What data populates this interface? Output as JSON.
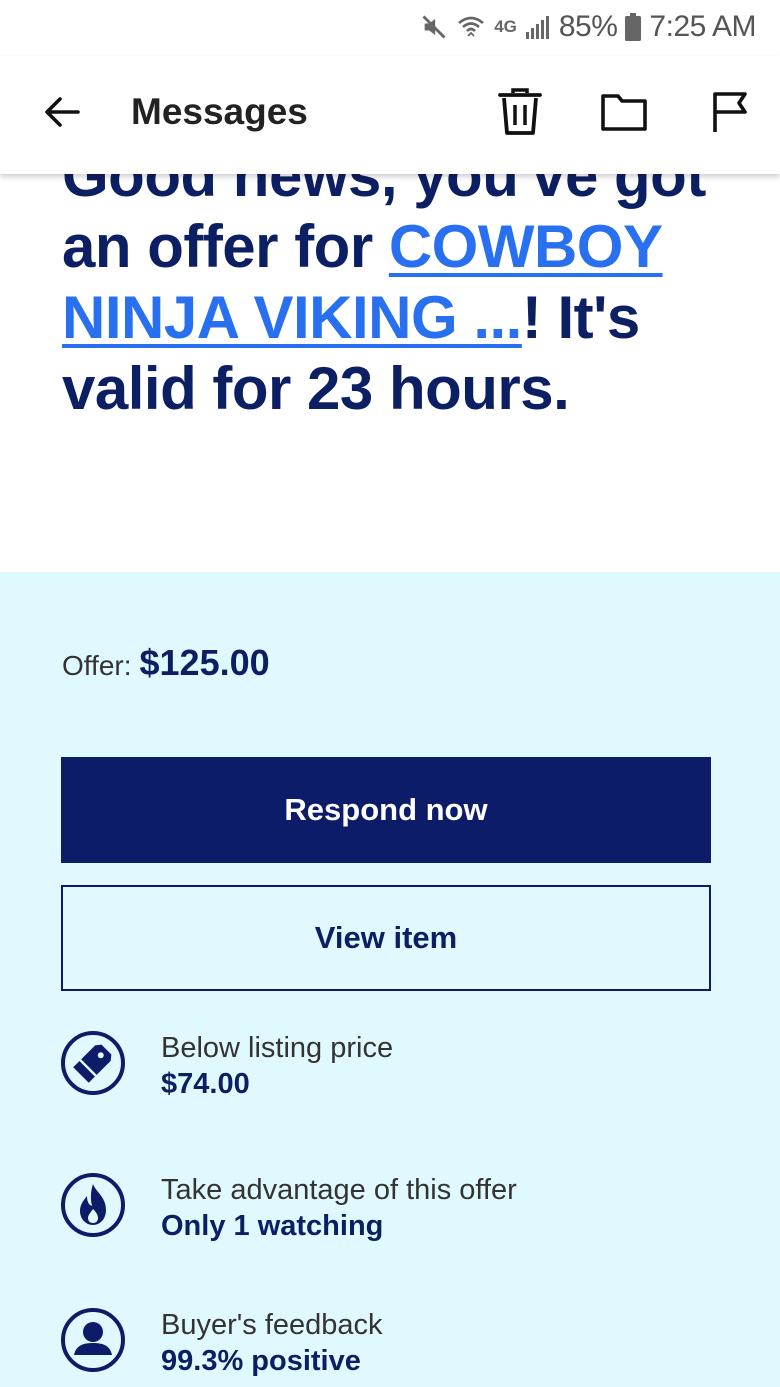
{
  "status_bar": {
    "network": "4G",
    "battery": "85%",
    "time": "7:25 AM"
  },
  "app_bar": {
    "title": "Messages"
  },
  "headline": {
    "part1": "Good news, you've got an offer for ",
    "item_link": "COWBOY NINJA VIKING ...",
    "part2": "! It's valid for 23 hours."
  },
  "offer": {
    "label": "Offer:",
    "amount": "$125.00",
    "respond_label": "Respond now",
    "view_label": "View item"
  },
  "info": [
    {
      "icon": "price-tag-icon",
      "label": "Below listing price",
      "value": "$74.00"
    },
    {
      "icon": "flame-icon",
      "label": "Take advantage of this offer",
      "value": "Only 1 watching"
    },
    {
      "icon": "person-icon",
      "label": "Buyer's feedback",
      "value": "99.3% positive"
    }
  ],
  "colors": {
    "navy": "#0d1c69",
    "headline": "#0d1f63",
    "link": "#2870f0",
    "panel_bg": "#e0f9fe"
  }
}
